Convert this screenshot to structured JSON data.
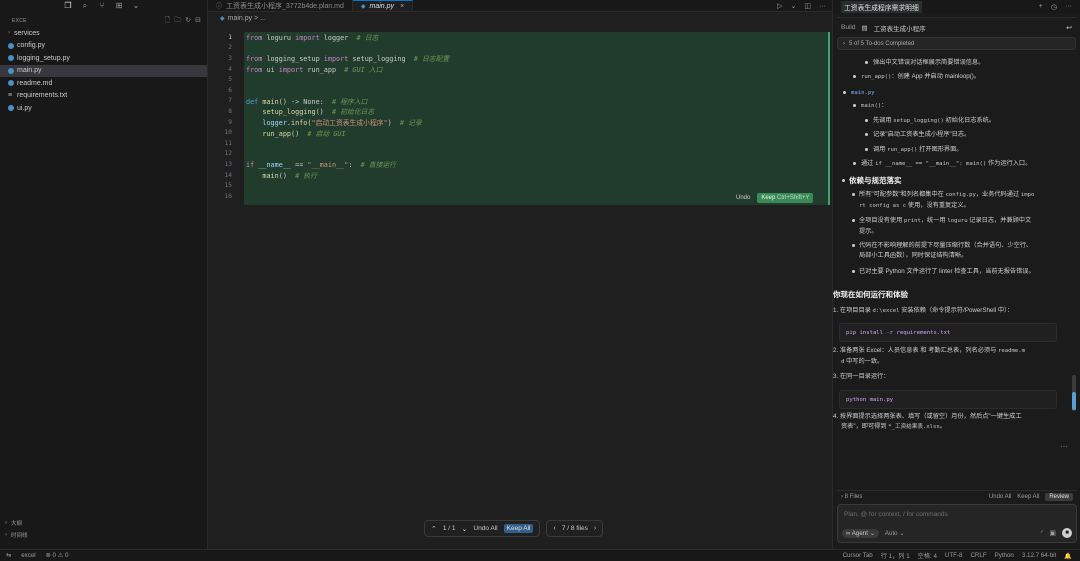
{
  "sidebar": {
    "toolbar_icons": [
      "copy-icon",
      "search-icon",
      "source-control-icon",
      "extensions-icon",
      "chevron-down-icon"
    ],
    "explorer_title": "EXCE",
    "items": [
      {
        "label": "services",
        "kind": "folder"
      },
      {
        "label": "config.py",
        "kind": "py"
      },
      {
        "label": "logging_setup.py",
        "kind": "py"
      },
      {
        "label": "main.py",
        "kind": "py",
        "selected": true
      },
      {
        "label": "readme.md",
        "kind": "md"
      },
      {
        "label": "requirements.txt",
        "kind": "txt"
      },
      {
        "label": "ui.py",
        "kind": "py"
      }
    ],
    "bottom": [
      "大纲",
      "时间线"
    ]
  },
  "tabs": [
    {
      "label": "工资表生成小程序_3772b4de.plan.md",
      "active": false
    },
    {
      "label": "main.py",
      "active": true
    }
  ],
  "breadcrumb": "main.py > ...",
  "code": {
    "lines": [
      {
        "n": "1"
      },
      {
        "n": "2"
      },
      {
        "n": "3"
      },
      {
        "n": "4"
      },
      {
        "n": "5"
      },
      {
        "n": "6"
      },
      {
        "n": "7"
      },
      {
        "n": "8"
      },
      {
        "n": "9"
      },
      {
        "n": "10"
      },
      {
        "n": "11"
      },
      {
        "n": "12"
      },
      {
        "n": "13"
      },
      {
        "n": "14"
      },
      {
        "n": "15"
      },
      {
        "n": "16"
      }
    ],
    "t1a": "from",
    "t1b": " loguru ",
    "t1c": "import",
    "t1d": " logger",
    "t1e": "  # 日志",
    "t3a": "from",
    "t3b": " logging_setup ",
    "t3c": "import",
    "t3d": " setup_logging",
    "t3e": "  # 日志配置",
    "t4a": "from",
    "t4b": " ui ",
    "t4c": "import",
    "t4d": " run_app",
    "t4e": "  # GUI 入口",
    "t7a": "def",
    "t7b": " main",
    "t7c": "() -> None:",
    "t7d": "  # 程序入口",
    "t8a": "    setup_logging",
    "t8b": "()",
    "t8c": "  # 初始化日志",
    "t9a": "    logger",
    "t9b": ".info(",
    "t9c": "\"启动工资表生成小程序\"",
    "t9d": ")",
    "t9e": "  # 记录",
    "t10a": "    run_app",
    "t10b": "()",
    "t10c": "  # 启动 GUI",
    "t13a": "if",
    "t13b": " __name__",
    "t13c": " == ",
    "t13d": "\"__main__\"",
    "t13e": ":",
    "t13f": "  # 直接运行",
    "t14a": "    main",
    "t14b": "()",
    "t14c": "  # 执行"
  },
  "inline_actions": {
    "undo": "Undo",
    "keep": "Keep",
    "keep_shortcut": "Ctrl+Shift+Y"
  },
  "review_bar": {
    "hunk": "1 / 1",
    "undo_all": "Undo All",
    "keep_all": "Keep All",
    "files": "7 / 8 files"
  },
  "chat": {
    "title": "工资表生成程序需求明细",
    "build_label": "Build",
    "build_title": "工资表生成小程序",
    "todos": "5 of 5 To-dos Completed",
    "b1": "弹出中文错误对话框展示简要错误信息。",
    "b2a": "run_app()",
    "b2b": "：创建 App 并启动 mainloop()。",
    "b3": "main.py",
    "b4a": "main()",
    "b4b": "：",
    "b5a": "先调用 ",
    "b5b": "setup_logging()",
    "b5c": " 初始化日志系统。",
    "b6": "记录\"启动工资表生成小程序\"日志。",
    "b7a": "调用 ",
    "b7b": "run_app()",
    "b7c": " 打开图形界面。",
    "b8a": "通过 ",
    "b8b": "if __name__ == \"__main__\": main()",
    "b8c": " 作为运行入口。",
    "h1": "依赖与规范落实",
    "c1a": "所有\"可配参数\"和列名都集中在 ",
    "c1b": "config.py",
    "c1c": "，业务代码通过 ",
    "c1d": "impo",
    "c1e": "rt config as c",
    "c1f": " 使用，没有重复定义。",
    "c2a": "全项目没有使用 ",
    "c2b": "print",
    "c2c": "，统一用 ",
    "c2d": "loguru",
    "c2e": " 记录日志，并兼顾中文",
    "c2f": "提示。",
    "c3a": "代码在不影响理解的前提下尽量压缩行数（合并语句、少空行、",
    "c3b": "局部小工具函数），同时保证结构清晰。",
    "c4": "已对主要 Python 文件运行了 linter 检查工具，当前无报告错误。",
    "h2": "你现在如何运行和体验",
    "d1a": "1. 在项目目录 ",
    "d1b": "d:\\excel",
    "d1c": " 安装依赖（命令提示符/PowerShell 中）：",
    "code1": "pip install -r requirements.txt",
    "d2a": "2. 准备两张 Excel：人员信息表 和 考勤汇总表，列名必须与 ",
    "d2b": "readme.m",
    "d2c": "d",
    "d2d": " 中写的一致。",
    "d3": "3. 在同一目录运行：",
    "code2": "python main.py",
    "d4a": "4. 按界面提示选择两张表、填写（或留空）月份，然后点\"一键生成工",
    "d4b": "资表\"，即可得到 ",
    "d4c": "*_工资结果表.xlsx",
    "d4d": "。",
    "files_count": "8 Files",
    "files_undo": "Undo All",
    "files_keep": "Keep All",
    "files_review": "Review",
    "input_placeholder": "Plan, @ for context, / for commands",
    "agent": "Agent",
    "auto": "Auto"
  },
  "status": {
    "left": [
      "excel",
      "⊗ 0 ⚠ 0"
    ],
    "right": [
      "Cursor Tab",
      "行 1，列 1",
      "空格: 4",
      "UTF-8",
      "CRLF",
      "Python",
      "3.12.7 64-bit"
    ]
  },
  "colors": {
    "accent": "#0078d4",
    "diff_bg": "#213b2d",
    "keep_green": "#3a8a58"
  }
}
